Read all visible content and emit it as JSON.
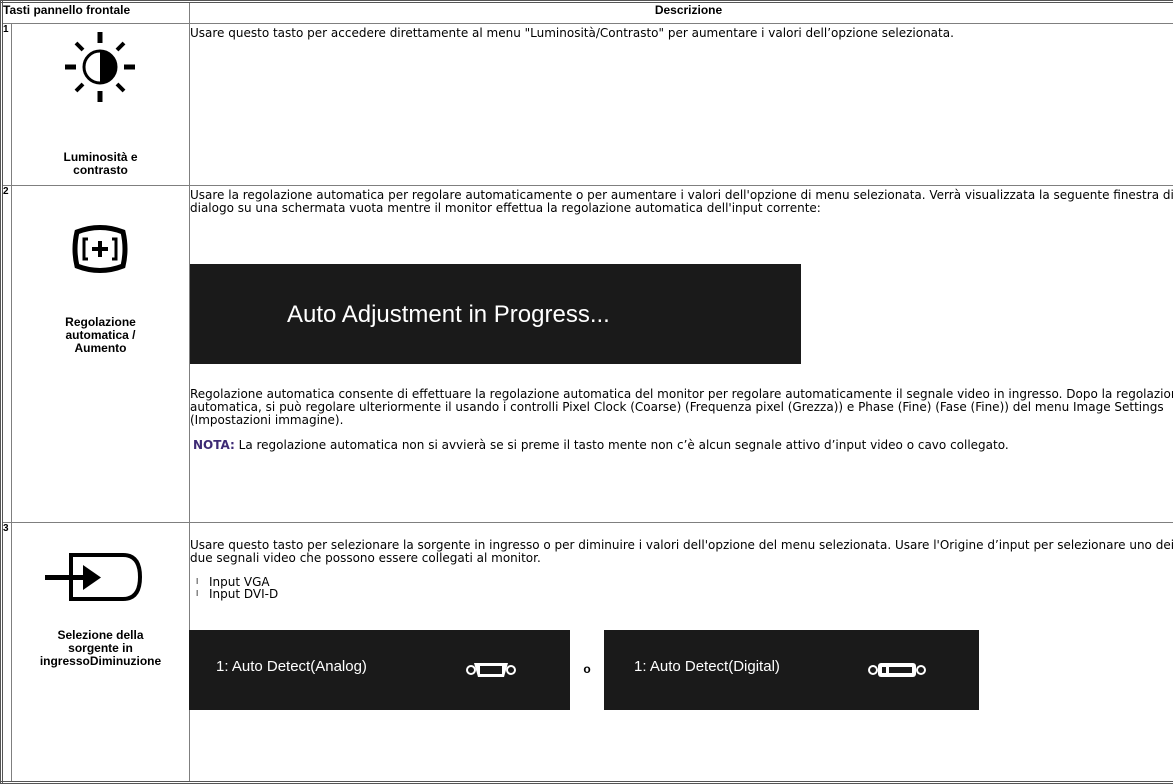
{
  "table": {
    "headers": {
      "keys": "Tasti pannello frontale",
      "description": "Descrizione"
    },
    "rows": [
      {
        "number": "1",
        "icon": "brightness-contrast-icon",
        "label": "Luminosità e contrasto",
        "description": "Usare questo tasto per accedere direttamente al menu \"Luminosità/Contrasto\" per aumentare i valori dell’opzione selezionata."
      },
      {
        "number": "2",
        "icon": "auto-adjust-icon",
        "label": "Regolazione automatica / Aumento",
        "description": "Usare la regolazione automatica per regolare automaticamente o per aumentare i valori dell'opzione di menu selezionata. Verrà visualizzata la seguente finestra di dialogo su una schermata vuota mentre il monitor effettua la regolazione automatica dell'input corrente:",
        "osd_text": "Auto Adjustment in Progress...",
        "description2": "Regolazione automatica consente di effettuare la regolazione automatica del monitor per regolare automaticamente il segnale video in ingresso. Dopo la regolazione automatica, si può regolare ulteriormente il usando i controlli Pixel Clock (Coarse) (Frequenza pixel (Grezza)) e Phase (Fine) (Fase (Fine)) del menu Image Settings (Impostazioni immagine).",
        "note_label": "NOTA:",
        "note_text": "La regolazione automatica non si avvierà se si preme il tasto mente non c’è alcun segnale attivo d’input video o cavo collegato."
      },
      {
        "number": "3",
        "icon": "input-source-icon",
        "label_line1": "Selezione della sorgente in",
        "label_line2": "ingressoDiminuzione",
        "description": "Usare questo tasto per selezionare la sorgente in ingresso o per diminuire i valori dell'opzione del menu selezionata. Usare l'Origine d’input per selezionare uno dei due segnali video che possono essere collegati al monitor.",
        "inputs": [
          "Input VGA",
          "Input DVI-D"
        ],
        "bullet_glyph": "l",
        "osd_left": "1: Auto Detect(Analog)",
        "osd_separator": "o",
        "osd_right": "1: Auto Detect(Digital)"
      }
    ]
  },
  "colors": {
    "osd_background": "#1a1a1a",
    "note_label": "#3d2a74",
    "border": "#7f7f7f"
  }
}
